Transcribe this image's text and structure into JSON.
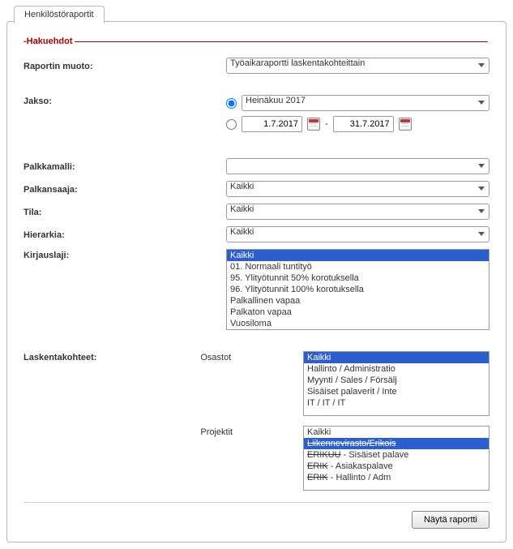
{
  "tab": {
    "label": "Henkilöstöraportit"
  },
  "fieldset_title": "Hakuehdot",
  "labels": {
    "raportin_muoto": "Raportin muoto:",
    "jakso": "Jakso:",
    "palkkamalli": "Palkkamalli:",
    "palkansaaja": "Palkansaaja:",
    "tila": "Tila:",
    "hierarkia": "Hierarkia:",
    "kirjauslaji": "Kirjauslaji:",
    "laskentakohteet": "Laskentakohteet:",
    "osastot": "Osastot",
    "projektit": "Projektit"
  },
  "raportin_muoto": {
    "value": "Työaikaraportti laskentakohteittain"
  },
  "jakso": {
    "period_value": "Heinäkuu 2017",
    "date_from": "1.7.2017",
    "date_to": "31.7.2017",
    "separator": "-"
  },
  "palkkamalli": {
    "value": ""
  },
  "palkansaaja": {
    "value": "Kaikki"
  },
  "tila": {
    "value": "Kaikki"
  },
  "hierarkia": {
    "value": "Kaikki"
  },
  "kirjauslaji": {
    "options": [
      "Kaikki",
      "01. Normaali tuntityö",
      "95. Ylityötunnit 50% korotuksella",
      "96. Ylityötunnit 100% korotuksella",
      "Palkallinen vapaa",
      "Palkaton vapaa",
      "Vuosiloma"
    ],
    "selected_index": 0
  },
  "osastot": {
    "options": [
      "Kaikki",
      "Hallinto / Administratio",
      "Myynti / Sales / Försälj",
      "Sisäiset palaverit / Inte",
      "IT / IT / IT"
    ],
    "selected_index": 0
  },
  "projektit": {
    "options": [
      {
        "text": "Kaikki",
        "selected": false
      },
      {
        "text": "Liikennevirasto/Erikois",
        "selected": true,
        "strike": true
      },
      {
        "text": "ERIKUU - Sisäiset palave",
        "selected": false,
        "strike_prefix": true,
        "prefix": "ERIKUU",
        "rest": " - Sisäiset palave"
      },
      {
        "text": "ERIK - Asiakaspalave",
        "selected": false,
        "strike_prefix": true,
        "prefix": "ERIK",
        "rest": " - Asiakaspalave"
      },
      {
        "text": "ERIK - Hallinto / Adm",
        "selected": false,
        "strike_prefix": true,
        "prefix": "ERIK",
        "rest": " - Hallinto / Adm"
      }
    ]
  },
  "button": {
    "show_report": "Näytä raportti"
  }
}
